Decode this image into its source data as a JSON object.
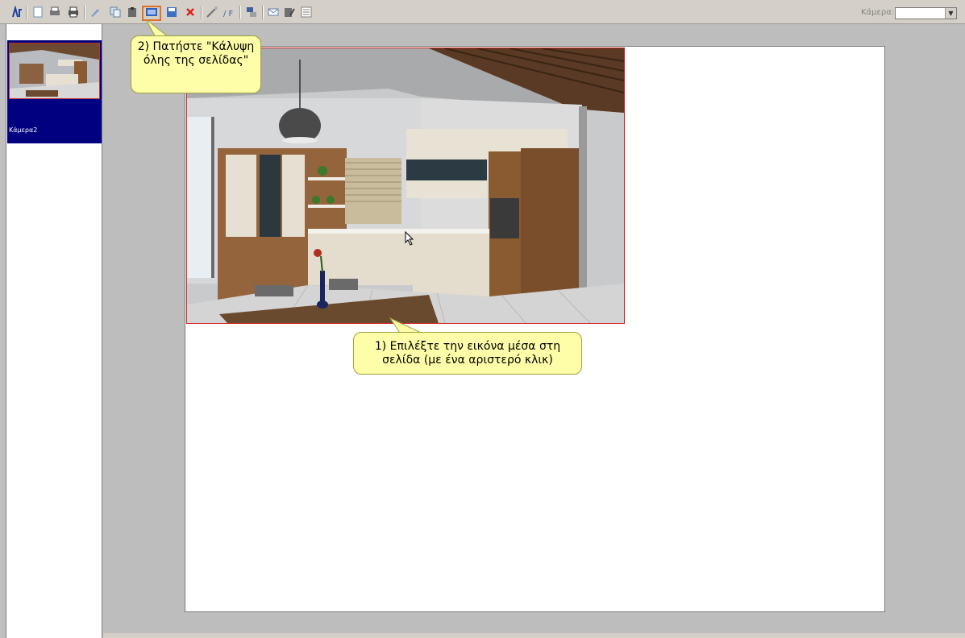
{
  "toolbar": {
    "icons": [
      "logo-icon",
      "new-page-icon",
      "print-setup-icon",
      "print-icon",
      "draw-icon",
      "copy-icon",
      "paste-icon",
      "fit-page-icon",
      "save-icon",
      "delete-icon",
      "wand-icon",
      "font-icon",
      "arrange-icon",
      "email-icon",
      "edit-icon",
      "properties-icon"
    ],
    "camera_label": "Κάμερα:",
    "camera_value": ""
  },
  "sidebar": {
    "thumbnails": [
      {
        "caption": "Κάμερα2"
      }
    ]
  },
  "callouts": {
    "step1": "1) Επιλέξτε την εικόνα μέσα στη σελίδα (με ένα αριστερό κλικ)",
    "step2": "2) Πατήστε \"Κάλυψη όλης της σελίδας\""
  },
  "colors": {
    "highlight": "#e0702a",
    "callout_bg": "#fefea8",
    "selection_border": "#d02020",
    "thumb_bg": "#000080"
  }
}
